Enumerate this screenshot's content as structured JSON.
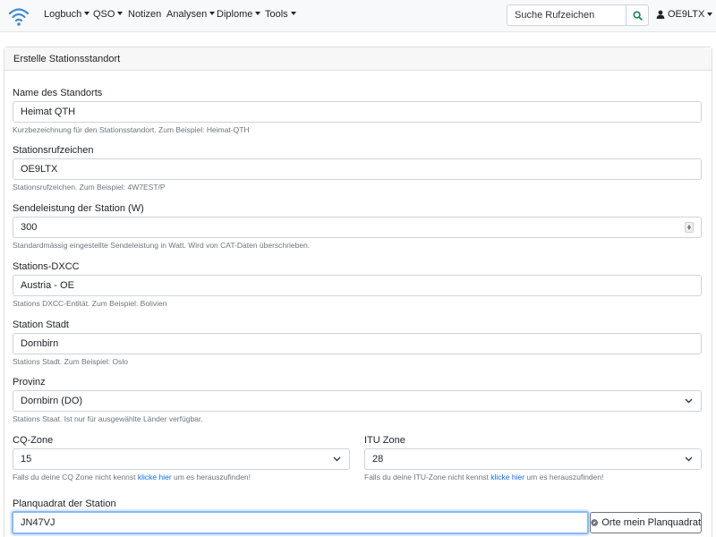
{
  "navbar": {
    "logo_icon": "wifi-logo-icon",
    "items": [
      {
        "label": "Logbuch",
        "dropdown": true
      },
      {
        "label": "QSO",
        "dropdown": true
      },
      {
        "label": "Notizen",
        "dropdown": false
      },
      {
        "label": "Analysen",
        "dropdown": true
      },
      {
        "label": "Diplome",
        "dropdown": true
      },
      {
        "label": "Tools",
        "dropdown": true
      }
    ],
    "search_placeholder": "Suche Rufzeichen",
    "search_icon": "search-icon",
    "user_label": "OE9LTX",
    "user_icon": "user-icon"
  },
  "card": {
    "title": "Erstelle Stationsstandort"
  },
  "form": {
    "location_name": {
      "label": "Name des Standorts",
      "value": "Heimat QTH",
      "help": "Kurzbezeichnung für den Stationsstandort. Zum Beispiel: Heimat-QTH"
    },
    "callsign": {
      "label": "Stationsrufzeichen",
      "value": "OE9LTX",
      "help": "Stationsrufzeichen. Zum Beispiel: 4W7EST/P"
    },
    "power": {
      "label": "Sendeleistung der Station (W)",
      "value": "300",
      "help": "Standardmässig eingestellte Sendeleistung in Watt. Wird von CAT-Daten überschrieben."
    },
    "dxcc": {
      "label": "Stations-DXCC",
      "value": "Austria - OE",
      "help": "Stations DXCC-Entität. Zum Beispiel: Bolivien"
    },
    "city": {
      "label": "Station Stadt",
      "value": "Dornbirn",
      "help": "Stations Stadt. Zum Beispiel: Oslo"
    },
    "province": {
      "label": "Provinz",
      "value": "Dornbirn (DO)",
      "help": "Stations Staat. Ist nur für ausgewählte Länder verfügbar."
    },
    "cq_zone": {
      "label": "CQ-Zone",
      "value": "15",
      "help_before": "Falls du deine CQ Zone nicht kennst ",
      "help_link": "klicke hier",
      "help_after": " um es herauszufinden!"
    },
    "itu_zone": {
      "label": "ITU Zone",
      "value": "28",
      "help_before": "Falls du deine ITU-Zone nicht kennst ",
      "help_link": "klicke hier",
      "help_after": " um es herauszufinden!"
    },
    "gridsquare": {
      "label": "Planquadrat der Station",
      "value": "JN47VJ",
      "locate_button": "Orte mein Planquadrat",
      "locate_icon": "compass-icon"
    }
  },
  "colors": {
    "link": "#0d6efd",
    "navbar_bg": "#f8f9fa",
    "search_icon": "#198754",
    "logo": "#3d8bd4"
  }
}
